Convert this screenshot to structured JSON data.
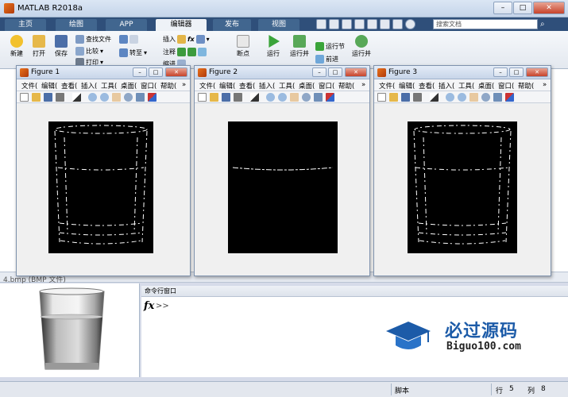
{
  "app": {
    "title": "MATLAB R2018a"
  },
  "window_buttons": [
    "–",
    "□",
    "✕"
  ],
  "tabs": [
    {
      "label": "主页",
      "active": false
    },
    {
      "label": "绘图",
      "active": false
    },
    {
      "label": "APP",
      "active": false
    },
    {
      "label": "编辑器",
      "active": true
    },
    {
      "label": "发布",
      "active": false
    },
    {
      "label": "视图",
      "active": false
    }
  ],
  "search": {
    "placeholder": "搜索文档"
  },
  "ribbon": {
    "new_label": "新建",
    "open_label": "打开",
    "save_label": "保存",
    "find_files_label": "查找文件",
    "compare_label": "比较",
    "print_label": "打印",
    "goto_label": "转至",
    "insert_label": "插入",
    "comment_label": "注释",
    "indent_label": "缩进",
    "fx_label": "fx",
    "breakpoints_label": "断点",
    "run_label": "运行",
    "run_advance_label": "运行并",
    "run_section_label": "运行节",
    "advance_label": "前进",
    "run_time_label": "运行并"
  },
  "figures": [
    {
      "title": "Figure 1",
      "menu": [
        "文件(",
        "编辑(",
        "查看(",
        "插入(",
        "工具(",
        "桌面(",
        "窗口(",
        "帮助("
      ]
    },
    {
      "title": "Figure 2",
      "menu": [
        "文件(",
        "编辑(",
        "查看(",
        "插入(",
        "工具(",
        "桌面(",
        "窗口(",
        "帮助("
      ]
    },
    {
      "title": "Figure 3",
      "menu": [
        "文件(",
        "编辑(",
        "查看(",
        "插入(",
        "工具(",
        "桌面(",
        "窗口(",
        "帮助("
      ]
    }
  ],
  "file_preview": {
    "label": "4.bmp (BMP 文件)"
  },
  "command_window": {
    "title": "命令行窗口",
    "prompt": ">>",
    "fx": "fx"
  },
  "watermark": {
    "name": "必过源码",
    "url": "Biguo100.com"
  },
  "status": {
    "script": "脚本",
    "row_label": "行",
    "row": "5",
    "col_label": "列",
    "col": "8"
  },
  "colors": {
    "tabbar": "#2f4f7a",
    "accent": "#1c5ba8",
    "plot_bg": "#000000"
  }
}
